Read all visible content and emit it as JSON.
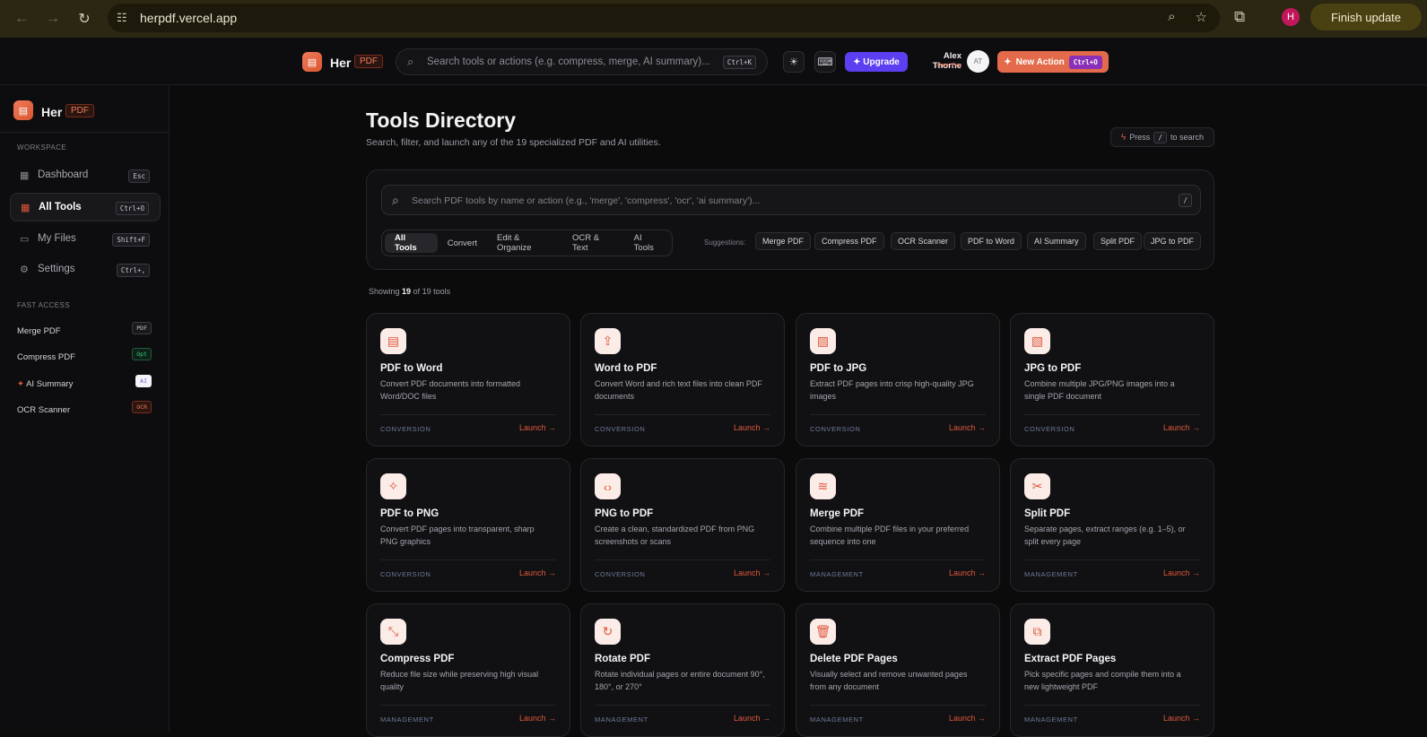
{
  "browser": {
    "url": "herpdf.vercel.app",
    "profile_initial": "H",
    "finish_update": "Finish update"
  },
  "topbar": {
    "brand": "Her",
    "brand_tag": "PDF",
    "search_placeholder": "Search tools or actions (e.g. compress, merge, AI summary)...",
    "search_kbd": "Ctrl+K",
    "upgrade": "Upgrade",
    "user_name": "Alex Thorne",
    "user_tier": "Free Tier",
    "avatar": "AT",
    "new_action": "New Action",
    "new_action_kbd": "Ctrl+O"
  },
  "sidebar": {
    "brand": "Her",
    "brand_tag": "PDF",
    "workspace_label": "WORKSPACE",
    "items": [
      {
        "label": "Dashboard",
        "kbd": "Esc",
        "icon": "dashboard-icon"
      },
      {
        "label": "All Tools",
        "kbd": "Ctrl+O",
        "icon": "grid-icon"
      },
      {
        "label": "My Files",
        "kbd": "Shift+F",
        "icon": "folder-icon"
      },
      {
        "label": "Settings",
        "kbd": "Ctrl+,",
        "icon": "gear-icon"
      }
    ],
    "fast_access_label": "FAST ACCESS",
    "fast_access": [
      {
        "label": "Merge PDF",
        "tag": "PDF"
      },
      {
        "label": "Compress PDF",
        "tag": "Opt"
      },
      {
        "label": "AI Summary",
        "tag": "AI"
      },
      {
        "label": "OCR Scanner",
        "tag": "OCR"
      }
    ]
  },
  "main": {
    "title": "Tools Directory",
    "subtitle": "Search, filter, and launch any of the 19 specialized PDF and AI utilities.",
    "press_prefix": "Press",
    "press_key": "/",
    "press_suffix": "to search",
    "search_placeholder": "Search PDF tools by name or action (e.g., 'merge', 'compress', 'ocr', 'ai summary')...",
    "search_kbd": "/",
    "tabs": [
      "All Tools",
      "Convert",
      "Edit & Organize",
      "OCR & Text",
      "AI Tools"
    ],
    "suggestions_label": "Suggestions:",
    "suggestions": [
      "Merge PDF",
      "Compress PDF",
      "OCR Scanner",
      "PDF to Word",
      "AI Summary",
      "Split PDF",
      "JPG to PDF"
    ],
    "showing_prefix": "Showing",
    "showing_count": "19",
    "showing_suffix": "of 19 tools"
  },
  "tools": [
    {
      "title": "PDF to Word",
      "desc": "Convert PDF documents into formatted Word/DOC files",
      "category": "CONVERSION",
      "launch": "Launch →",
      "icon": "document-icon"
    },
    {
      "title": "Word to PDF",
      "desc": "Convert Word and rich text files into clean PDF documents",
      "category": "CONVERSION",
      "launch": "Launch →",
      "icon": "upload-file-icon"
    },
    {
      "title": "PDF to JPG",
      "desc": "Extract PDF pages into crisp high-quality JPG images",
      "category": "CONVERSION",
      "launch": "Launch →",
      "icon": "image-icon"
    },
    {
      "title": "JPG to PDF",
      "desc": "Combine multiple JPG/PNG images into a single PDF document",
      "category": "CONVERSION",
      "launch": "Launch →",
      "icon": "image-file-icon"
    },
    {
      "title": "PDF to PNG",
      "desc": "Convert PDF pages into transparent, sharp PNG graphics",
      "category": "CONVERSION",
      "launch": "Launch →",
      "icon": "sparkles-icon"
    },
    {
      "title": "PNG to PDF",
      "desc": "Create a clean, standardized PDF from PNG screenshots or scans",
      "category": "CONVERSION",
      "launch": "Launch →",
      "icon": "code-file-icon"
    },
    {
      "title": "Merge PDF",
      "desc": "Combine multiple PDF files in your preferred sequence into one",
      "category": "MANAGEMENT",
      "launch": "Launch →",
      "icon": "layers-icon"
    },
    {
      "title": "Split PDF",
      "desc": "Separate pages, extract ranges (e.g. 1–5), or split every page",
      "category": "MANAGEMENT",
      "launch": "Launch →",
      "icon": "scissors-icon"
    },
    {
      "title": "Compress PDF",
      "desc": "Reduce file size while preserving high visual quality",
      "category": "MANAGEMENT",
      "launch": "Launch →",
      "icon": "minimize-icon"
    },
    {
      "title": "Rotate PDF",
      "desc": "Rotate individual pages or entire document 90°, 180°, or 270°",
      "category": "MANAGEMENT",
      "launch": "Launch →",
      "icon": "rotate-icon"
    },
    {
      "title": "Delete PDF Pages",
      "desc": "Visually select and remove unwanted pages from any document",
      "category": "MANAGEMENT",
      "launch": "Launch →",
      "icon": "trash-icon"
    },
    {
      "title": "Extract PDF Pages",
      "desc": "Pick specific pages and compile them into a new lightweight PDF",
      "category": "MANAGEMENT",
      "launch": "Launch →",
      "icon": "copy-check-icon"
    }
  ]
}
